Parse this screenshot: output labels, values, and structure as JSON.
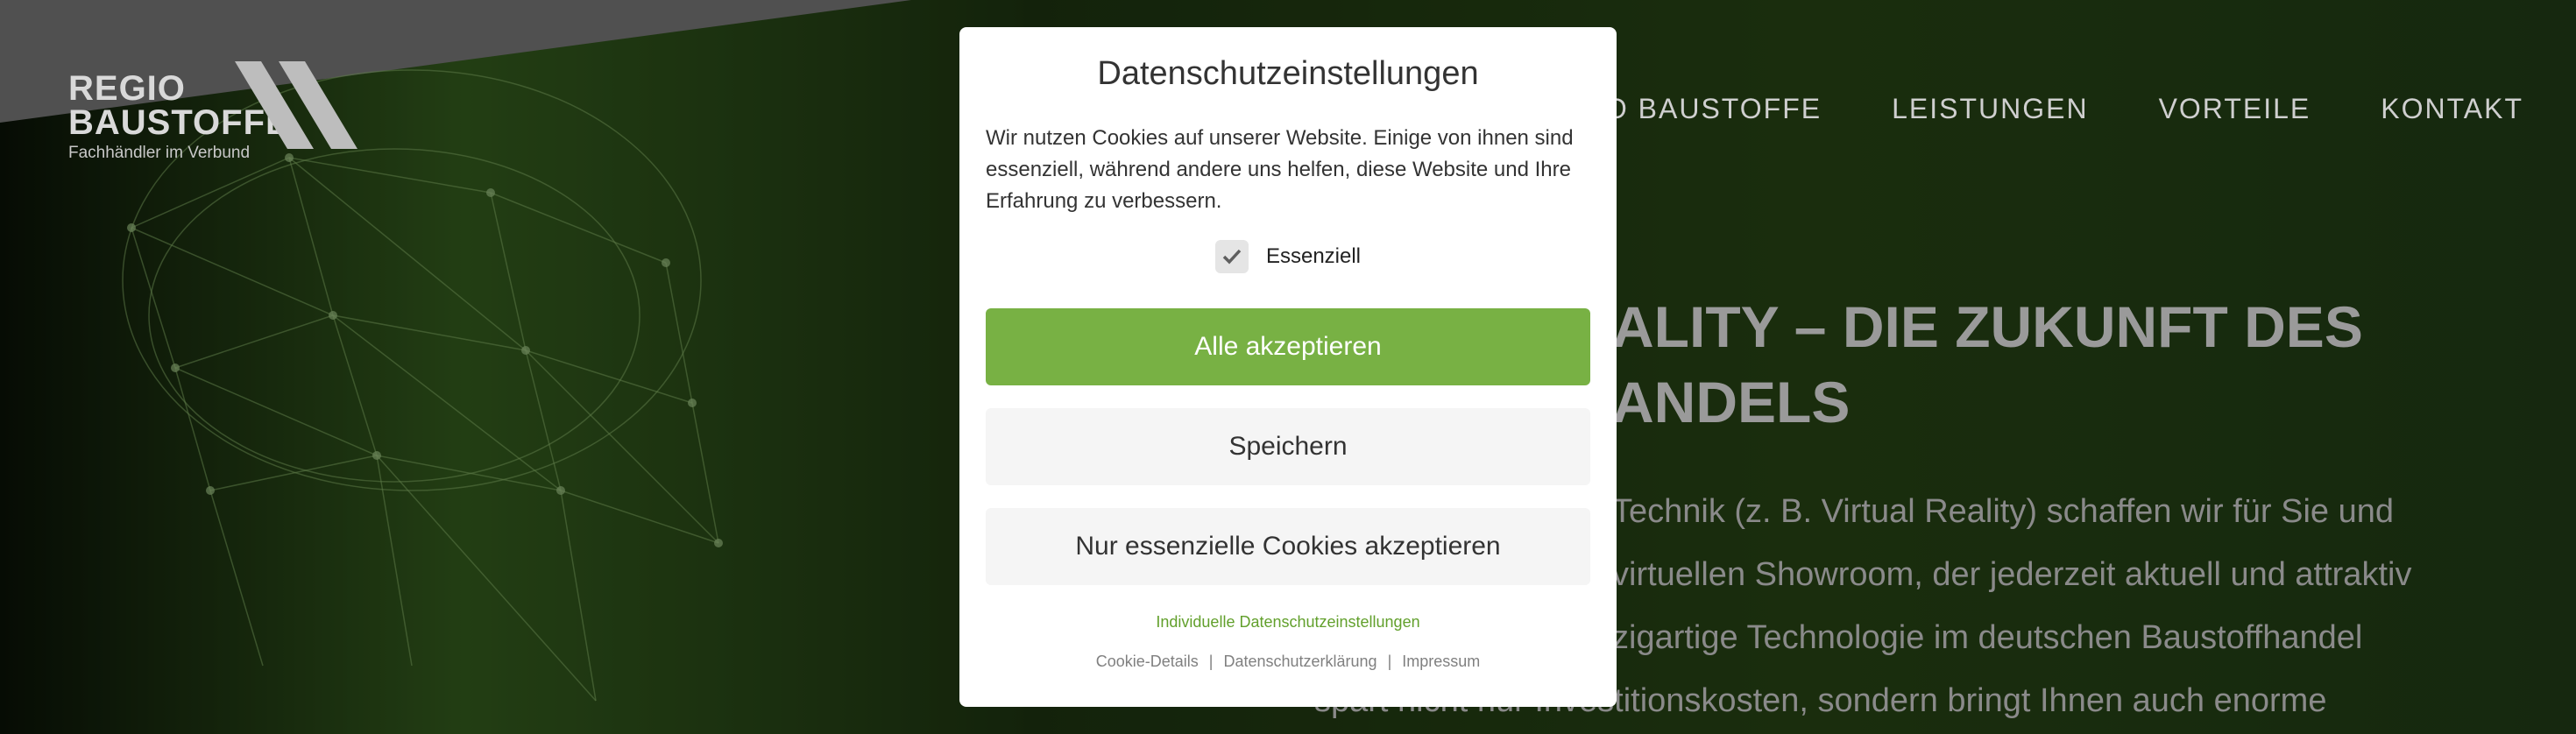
{
  "header": {
    "logo": {
      "line1": "REGIO",
      "line2": "BAUSTOFFE",
      "tagline": "Fachhändler im Verbund"
    },
    "nav": [
      {
        "label": "REGIO BAUSTOFFE"
      },
      {
        "label": "LEISTUNGEN"
      },
      {
        "label": "VORTEILE"
      },
      {
        "label": "KONTAKT"
      }
    ]
  },
  "hero": {
    "title_line1": "ALITY – DIE ZUKUNFT DES",
    "title_line2": "ANDELS",
    "text_lines": [
      "Technik (z. B. Virtual Reality) schaffen wir für Sie und",
      "virtuellen Showroom, der jederzeit aktuell und attraktiv",
      "zigartige Technologie im deutschen Baustoffhandel",
      "spart nicht nur Investitionskosten, sondern bringt Ihnen auch enorme"
    ]
  },
  "cookie_modal": {
    "title": "Datenschutzeinstellungen",
    "description": "Wir nutzen Cookies auf unserer Website. Einige von ihnen sind essenziell, während andere uns helfen, diese Website und Ihre Erfahrung zu verbessern.",
    "checkbox": {
      "label": "Essenziell",
      "checked": true
    },
    "buttons": {
      "accept_all": "Alle akzeptieren",
      "save": "Speichern",
      "essential_only": "Nur essenzielle Cookies akzeptieren"
    },
    "individual_link": "Individuelle Datenschutzeinstellungen",
    "footer_links": [
      {
        "label": "Cookie-Details"
      },
      {
        "label": "Datenschutzerklärung"
      },
      {
        "label": "Impressum"
      }
    ],
    "colors": {
      "accent": "#78b144",
      "link": "#62a02c"
    }
  },
  "icons": {
    "checkbox_check": "check-icon",
    "logo_mark": "logo-chevron-icon"
  }
}
